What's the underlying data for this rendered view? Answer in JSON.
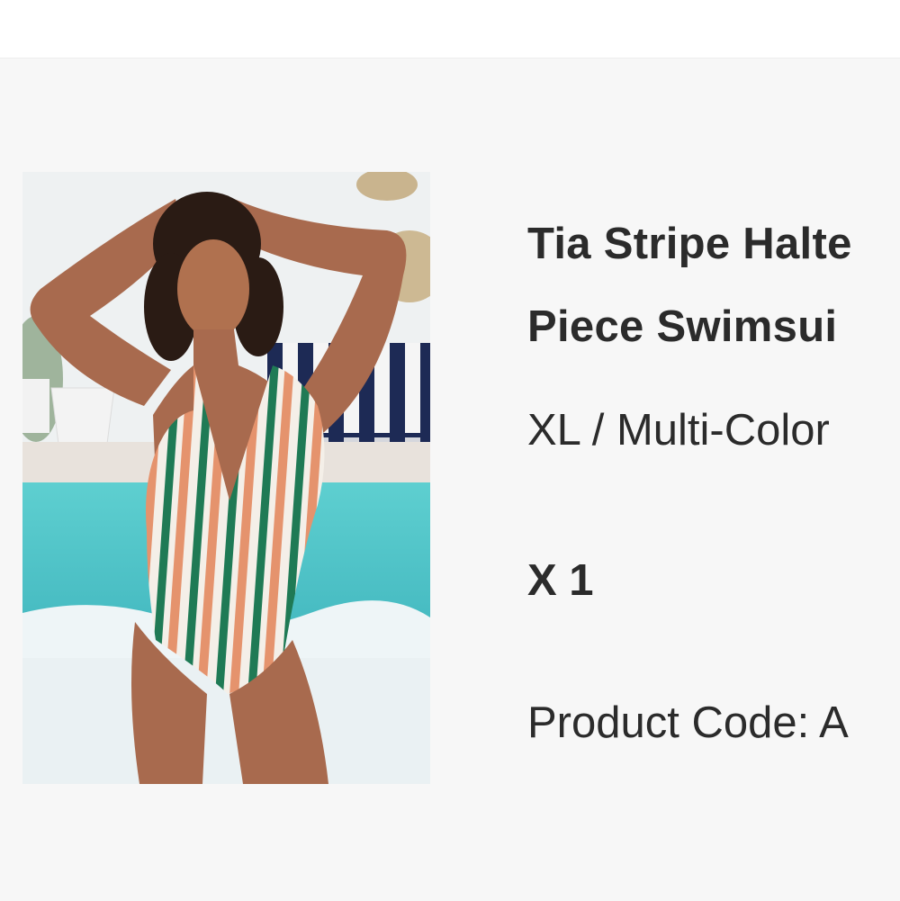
{
  "product": {
    "title_line1": "Tia Stripe Halte",
    "title_line2": "Piece Swimsui",
    "variant": "XL / Multi-Color",
    "quantity": "X 1",
    "product_code": "Product Code: A"
  },
  "colors": {
    "page_background": "#ffffff",
    "card_background": "#f7f7f7",
    "text": "#2b2b2b",
    "stripe_green": "#1f7a55",
    "stripe_orange": "#e5936d",
    "pool": "#4cc3c7",
    "cushion_navy": "#1d2a55"
  },
  "image": {
    "icon": "product-photo-swimsuit"
  }
}
